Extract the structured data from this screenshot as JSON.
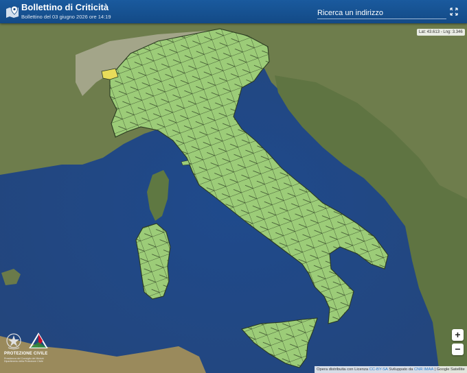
{
  "header": {
    "title": "Bollettino di Criticità",
    "subtitle": "Bollettino del 03 giugno 2026 ore 14:19",
    "search_placeholder": "Ricerca un indirizzo"
  },
  "map": {
    "coordinates": "Lat: 43.613 - Lng: 3.346",
    "zoom_in": "+",
    "zoom_out": "−",
    "region_fill": "#9ccc78",
    "region_border": "#2a3a20",
    "alert_fill": "#e8dc5a",
    "sea_color": "#2b5390",
    "land_color": "#6b7c4a"
  },
  "attribution": {
    "part1": "Opera distribuita con Licenza",
    "license": "CC-BY-SA",
    "part2": "Sviluppato da",
    "developer": "CNR IMAA",
    "part3": "| Google Satellite"
  },
  "logo": {
    "name": "PROTEZIONE CIVILE",
    "line1": "Presidenza del Consiglio dei Ministri",
    "line2": "Dipartimento della Protezione Civile"
  },
  "icons": [
    "map-marker-icon",
    "expand-icon",
    "zoom-in-icon",
    "zoom-out-icon",
    "emblem-icon",
    "pc-logo-icon"
  ]
}
